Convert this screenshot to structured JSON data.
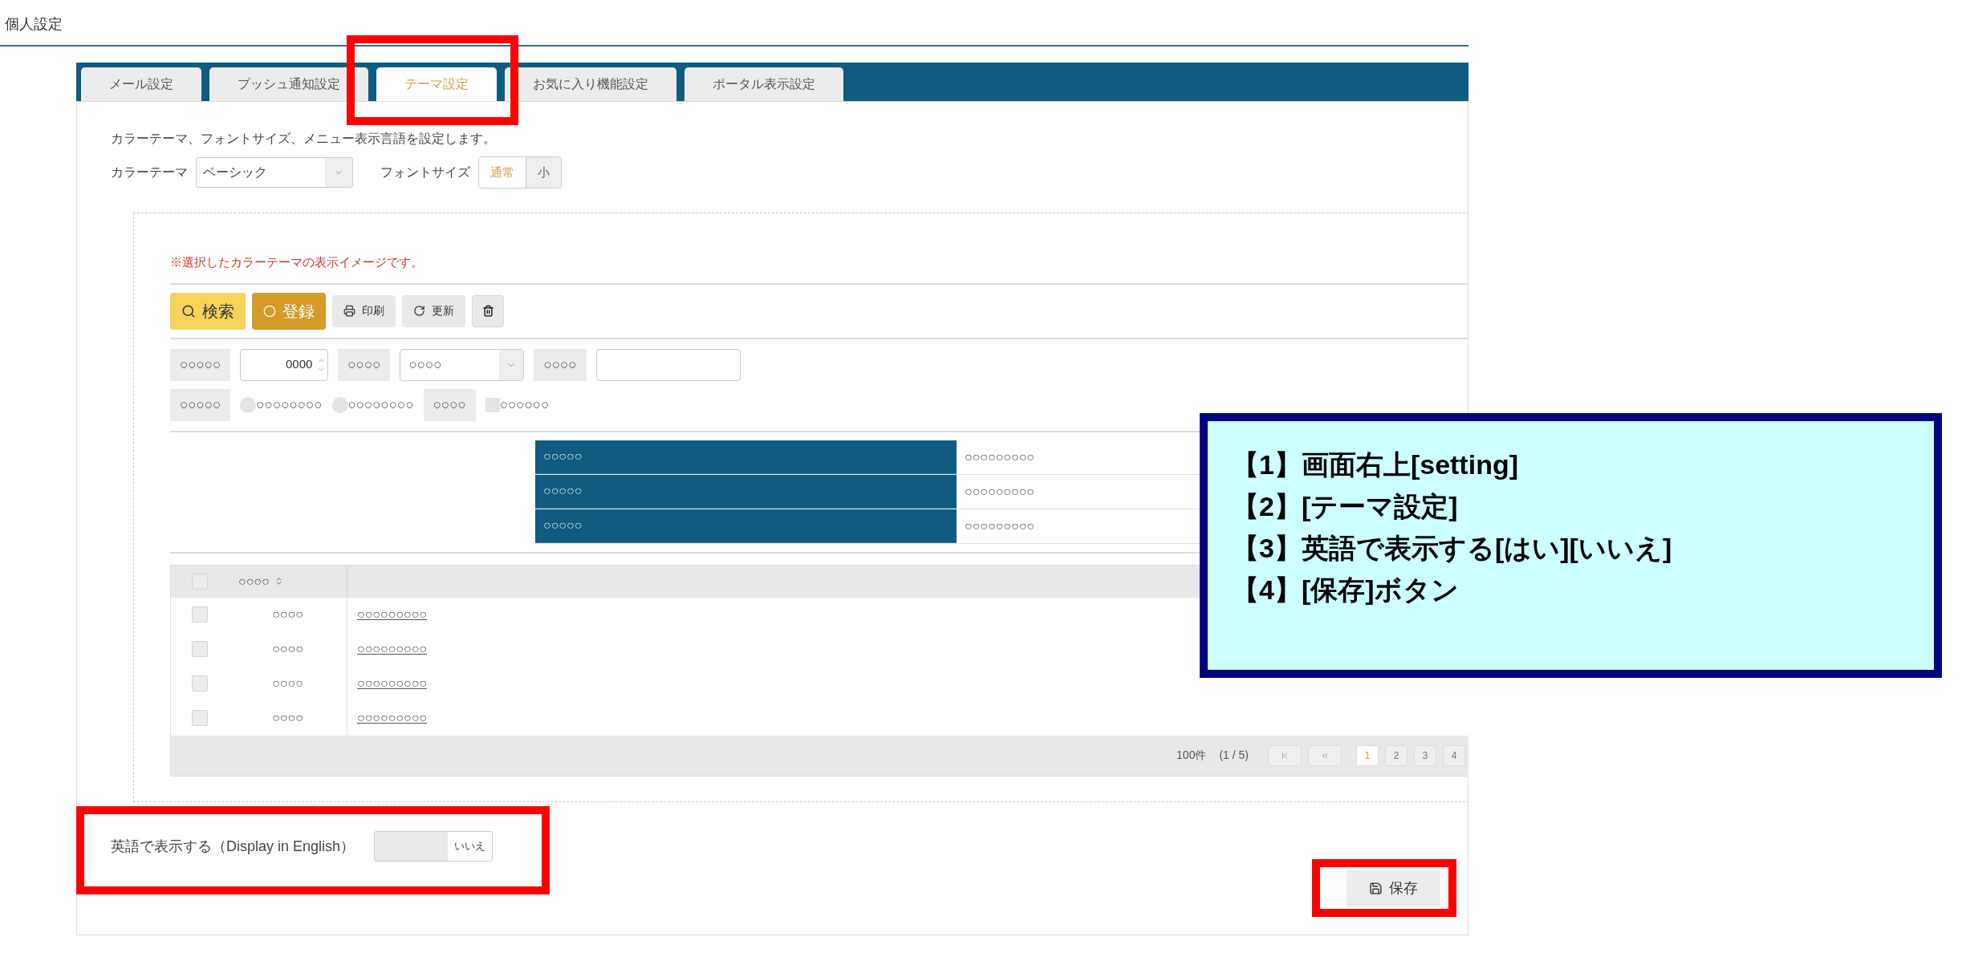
{
  "page_title": "個人設定",
  "tabs": [
    {
      "label": "メール設定",
      "selected": false
    },
    {
      "label": "プッシュ通知設定",
      "selected": false
    },
    {
      "label": "テーマ設定",
      "selected": true
    },
    {
      "label": "お気に入り機能設定",
      "selected": false
    },
    {
      "label": "ポータル表示設定",
      "selected": false
    }
  ],
  "description": "カラーテーマ、フォントサイズ、メニュー表示言語を設定します。",
  "color_theme": {
    "label": "カラーテーマ",
    "value": "ベーシック"
  },
  "font_size": {
    "label": "フォントサイズ",
    "options": [
      {
        "label": "通常",
        "selected": true
      },
      {
        "label": "小",
        "selected": false
      }
    ]
  },
  "preview": {
    "note": "※選択したカラーテーマの表示イメージです。",
    "toolbar": [
      {
        "kind": "search",
        "label": "検索"
      },
      {
        "kind": "register",
        "label": "登録"
      },
      {
        "kind": "print",
        "label": "印刷"
      },
      {
        "kind": "refresh",
        "label": "更新"
      },
      {
        "kind": "delete"
      }
    ],
    "form_rows": [
      [
        {
          "kind": "label",
          "text": "○○○○○"
        },
        {
          "kind": "spinner",
          "value": "0000"
        },
        {
          "kind": "label",
          "text": "○○○○"
        },
        {
          "kind": "select",
          "value": "○○○○"
        },
        {
          "kind": "label",
          "text": "○○○○"
        },
        {
          "kind": "input"
        }
      ],
      [
        {
          "kind": "label",
          "text": "○○○○○"
        },
        {
          "kind": "radio",
          "text": "○○○○○○○○",
          "selected": false
        },
        {
          "kind": "radio",
          "text": "○○○○○○○○",
          "selected": false
        },
        {
          "kind": "label",
          "text": "○○○○"
        },
        {
          "kind": "checkbox",
          "text": "○○○○○○",
          "checked": false
        }
      ]
    ],
    "detail_rows": [
      {
        "key": "○○○○○",
        "value": "○○○○○○○○○"
      },
      {
        "key": "○○○○○",
        "value": "○○○○○○○○○"
      },
      {
        "key": "○○○○○",
        "value": "○○○○○○○○○"
      }
    ],
    "grid": {
      "header_checked": false,
      "column": "○○○○",
      "rows": [
        {
          "checked": false,
          "code": "○○○○",
          "link": "○○○○○○○○○"
        },
        {
          "checked": false,
          "code": "○○○○",
          "link": "○○○○○○○○○"
        },
        {
          "checked": false,
          "code": "○○○○",
          "link": "○○○○○○○○○"
        },
        {
          "checked": false,
          "code": "○○○○",
          "link": "○○○○○○○○○"
        }
      ],
      "count": "100件",
      "page_info": "(1 / 5)",
      "pages": [
        {
          "label": "1",
          "selected": true
        },
        {
          "label": "2",
          "selected": false
        },
        {
          "label": "3",
          "selected": false
        },
        {
          "label": "4",
          "selected": false
        }
      ]
    }
  },
  "english": {
    "label": "英語で表示する（Display in English）",
    "on": false,
    "state_label": "いいえ"
  },
  "save_button": "保存",
  "callout": [
    "【1】画面右上[setting]",
    "【2】[テーマ設定]",
    "【3】英語で表示する[はい][いいえ]",
    "【4】[保存]ボタン"
  ]
}
